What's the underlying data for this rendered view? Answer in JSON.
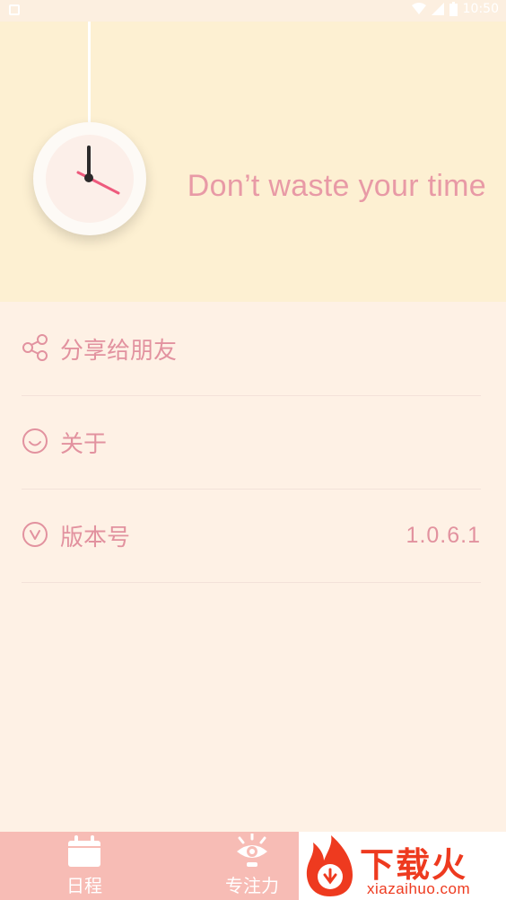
{
  "status_bar": {
    "time": "10:50"
  },
  "header": {
    "tagline": "Don’t waste your time"
  },
  "menu": {
    "items": [
      {
        "label": "分享给朋友",
        "icon": "share-icon"
      },
      {
        "label": "关于",
        "icon": "smile-icon"
      },
      {
        "label": "版本号",
        "icon": "chevron-down-circle-icon",
        "value": "1.0.6.1"
      }
    ]
  },
  "bottom_nav": {
    "items": [
      {
        "label": "日程",
        "icon": "calendar-icon"
      },
      {
        "label": "专注力",
        "icon": "eye-bulb-icon"
      }
    ]
  },
  "watermark": {
    "title": "下载火",
    "subtitle": "xiazaihuo.com"
  },
  "colors": {
    "accent": "#e2929f",
    "header_bg": "#fdf0d2",
    "page_bg": "#fef1e5",
    "nav_bg": "#f7bcb5"
  }
}
